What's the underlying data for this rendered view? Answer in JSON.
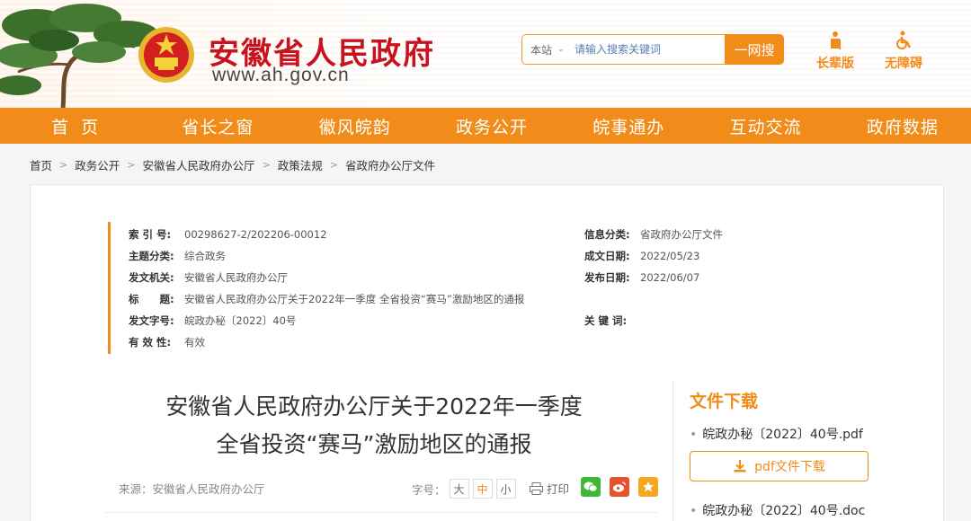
{
  "header": {
    "site_title": "安徽省人民政府",
    "site_url": "www.ah.gov.cn",
    "search": {
      "scope": "本站",
      "placeholder": "请输入搜索关键词",
      "button": "一网搜"
    },
    "quick_links": [
      {
        "label": "长辈版",
        "icon": "elder-icon"
      },
      {
        "label": "无障碍",
        "icon": "wheelchair-icon"
      }
    ]
  },
  "nav": [
    "首页",
    "省长之窗",
    "徽风皖韵",
    "政务公开",
    "皖事通办",
    "互动交流",
    "政府数据"
  ],
  "breadcrumb": [
    "首页",
    "政务公开",
    "安徽省人民政府办公厅",
    "政策法规",
    "省政府办公厅文件"
  ],
  "meta": {
    "left": [
      {
        "key": "索 引 号:",
        "value": "00298627-2/202206-00012"
      },
      {
        "key": "主题分类:",
        "value": "综合政务"
      },
      {
        "key": "发文机关:",
        "value": "安徽省人民政府办公厅"
      },
      {
        "key": "标　　题:",
        "value": "安徽省人民政府办公厅关于2022年一季度 全省投资“赛马”激励地区的通报"
      },
      {
        "key": "发文字号:",
        "value": "皖政办秘〔2022〕40号"
      },
      {
        "key": "有 效 性:",
        "value": "有效"
      }
    ],
    "right": [
      {
        "key": "信息分类:",
        "value": "省政府办公厅文件"
      },
      {
        "key": "成文日期:",
        "value": "2022/05/23"
      },
      {
        "key": "发布日期:",
        "value": "2022/06/07"
      },
      {
        "key": "关 键 词:",
        "value": ""
      }
    ]
  },
  "article": {
    "title_line1": "安徽省人民政府办公厅关于2022年一季度",
    "title_line2": "全省投资“赛马”激励地区的通报",
    "source": "来源：安徽省人民政府办公厅",
    "font_size_label": "字号：",
    "font_sizes": [
      "大",
      "中",
      "小"
    ],
    "active_font_size": "中",
    "print_label": "打印"
  },
  "downloads": {
    "title": "文件下载",
    "files": [
      "皖政办秘〔2022〕40号.pdf",
      "皖政办秘〔2022〕40号.doc"
    ],
    "pdf_button": "pdf文件下载"
  },
  "colors": {
    "accent": "#f18c1a",
    "title_red": "#c8131f",
    "wechat": "#3fb837",
    "weibo": "#e6522c",
    "favorite": "#f5a623"
  }
}
